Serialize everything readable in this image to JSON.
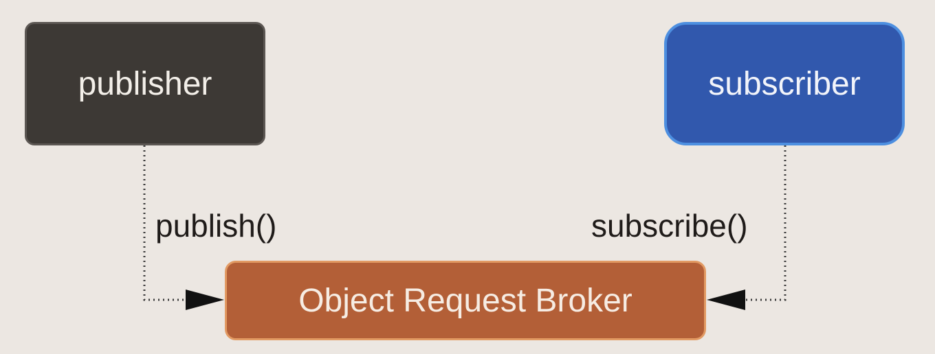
{
  "diagram": {
    "nodes": {
      "publisher": {
        "label": "publisher"
      },
      "subscriber": {
        "label": "subscriber"
      },
      "broker": {
        "label": "Object Request Broker"
      }
    },
    "edges": [
      {
        "from": "publisher",
        "to": "broker",
        "label": "publish()",
        "style": "dotted",
        "arrowhead": "filled"
      },
      {
        "from": "subscriber",
        "to": "broker",
        "label": "subscribe()",
        "style": "dotted",
        "arrowhead": "filled"
      }
    ],
    "colors": {
      "background": "#ece7e2",
      "publisher_fill": "#3d3935",
      "subscriber_fill": "#3158ad",
      "broker_fill": "#b35f37",
      "connector": "#3a3a3a"
    }
  }
}
